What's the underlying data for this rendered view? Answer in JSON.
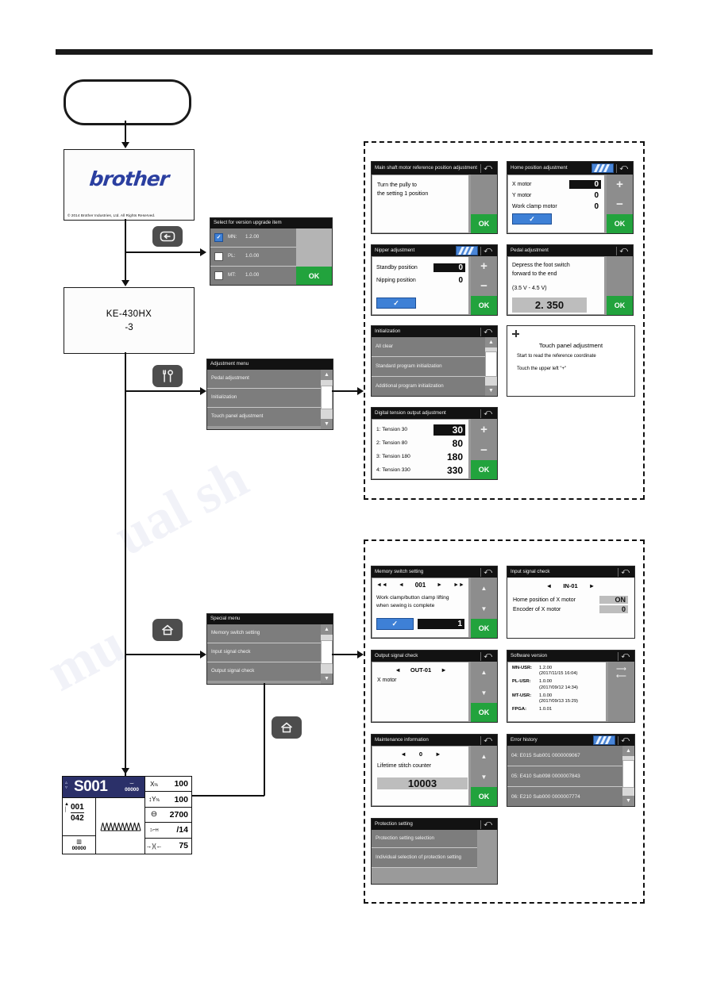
{
  "start_node": {
    "label": ""
  },
  "brother_screen": {
    "logo": "brother",
    "copyright": "© 2014 Brother Industries, Ltd. All Rights Reserved."
  },
  "model_screen": {
    "line1": "KE-430HX",
    "line2": "-3"
  },
  "keys": {
    "back": "back-key",
    "tools": "tools-key",
    "home1": "home-key",
    "home2": "home-key"
  },
  "version_upgrade": {
    "title": "Select for version upgrade item",
    "rows": [
      {
        "checked": true,
        "name": "MN:",
        "version": "1.2.00"
      },
      {
        "checked": false,
        "name": "PL:",
        "version": "1.0.00"
      },
      {
        "checked": false,
        "name": "MT:",
        "version": "1.0.00"
      }
    ],
    "ok": "OK"
  },
  "adjustment_menu": {
    "title": "Adjustment menu",
    "items": [
      "Pedal adjustment",
      "Initialization",
      "Touch panel adjustment"
    ]
  },
  "special_menu": {
    "title": "Special menu",
    "items": [
      "Memory switch setting",
      "Input signal check",
      "Output signal check"
    ]
  },
  "panels": {
    "main_shaft": {
      "title": "Main shaft motor reference position adjustment",
      "body_line1": "Turn the pully to",
      "body_line2": "the setting 1  position",
      "ok": "OK"
    },
    "home_position": {
      "title": "Home position adjustment",
      "rows": [
        {
          "label": "X motor",
          "value": "0"
        },
        {
          "label": "Y motor",
          "value": "0"
        },
        {
          "label": "Work clamp motor",
          "value": "0"
        }
      ],
      "plus": "+",
      "minus": "−",
      "ok": "OK"
    },
    "nipper": {
      "title": "Nipper adjustment",
      "rows": [
        {
          "label": "Standby position",
          "value": "0"
        },
        {
          "label": "Nipping position",
          "value": "0"
        }
      ],
      "plus": "+",
      "minus": "−",
      "ok": "OK"
    },
    "pedal": {
      "title": "Pedal adjustment",
      "line1": "Depress the foot switch",
      "line2": "forward to the end",
      "range": "(3.5 V - 4.5 V)",
      "value": "2. 350",
      "ok": "OK"
    },
    "initialization": {
      "title": "Initialization",
      "items": [
        "All clear",
        "Standard program initialization",
        "Additional program initialization"
      ]
    },
    "touch_panel": {
      "title": "Touch panel adjustment",
      "line1": "Start to read the reference coordinate",
      "line2": "Touch the upper left \"+\""
    },
    "digital_tension": {
      "title": "Digital tension output adjustment",
      "rows": [
        {
          "label": "1: Tension 30",
          "value": "30"
        },
        {
          "label": "2: Tension 80",
          "value": "80"
        },
        {
          "label": "3: Tension 180",
          "value": "180"
        },
        {
          "label": "4: Tension 330",
          "value": "330"
        }
      ],
      "plus": "+",
      "minus": "−",
      "ok": "OK"
    },
    "memory_switch": {
      "title": "Memory switch setting",
      "number": "001",
      "desc_line1": "Work clamp/button clamp lifting",
      "desc_line2": "when sewing is complete",
      "value": "1",
      "ok": "OK"
    },
    "input_signal": {
      "title": "Input signal check",
      "channel": "IN-01",
      "rows": [
        {
          "label": "Home position of X motor",
          "value": "ON"
        },
        {
          "label": "Encoder of X motor",
          "value": "0"
        }
      ]
    },
    "output_signal": {
      "title": "Output signal check",
      "channel": "OUT-01",
      "body": "X motor",
      "ok": "OK"
    },
    "software_version": {
      "title": "Software version",
      "rows": [
        {
          "label": "MN-USR:",
          "version": "1.2.00",
          "date": "(2017/11/15 16:04)"
        },
        {
          "label": "PL-USR:",
          "version": "1.0.00",
          "date": "(2017/09/12 14:34)"
        },
        {
          "label": "MT-USR:",
          "version": "1.0.00",
          "date": "(2017/09/13 15:29)"
        },
        {
          "label": "FPGA:",
          "version": "1.0.01",
          "date": ""
        }
      ]
    },
    "maintenance": {
      "title": "Maintenance information",
      "number": "0",
      "body": "Lifetime stitch counter",
      "value": "10003",
      "ok": "OK"
    },
    "error_history": {
      "title": "Error history",
      "rows": [
        "04:  E015  Sub001  0000009067",
        "05:  E410  Sub098  0000007843",
        "06:  E210  Sub000  0000007774"
      ]
    },
    "protection": {
      "title": "Protection setting",
      "items": [
        "Protection setting selection",
        "Individual selection of protection setting"
      ]
    }
  },
  "main_screen": {
    "program_no": "S001",
    "bobbin_counter": "00000",
    "stitch_current": "001",
    "stitch_total": "042",
    "production_counter": "00000",
    "rows": [
      {
        "icon": "x-scale-icon",
        "label": "X %",
        "value": "100"
      },
      {
        "icon": "y-scale-icon",
        "label": "Y %",
        "value": "100"
      },
      {
        "icon": "speed-icon",
        "label": "",
        "value": "2700"
      },
      {
        "icon": "clamp-icon",
        "label": "H",
        "value": "/14"
      },
      {
        "icon": "width-icon",
        "label": "",
        "value": "75"
      }
    ]
  }
}
